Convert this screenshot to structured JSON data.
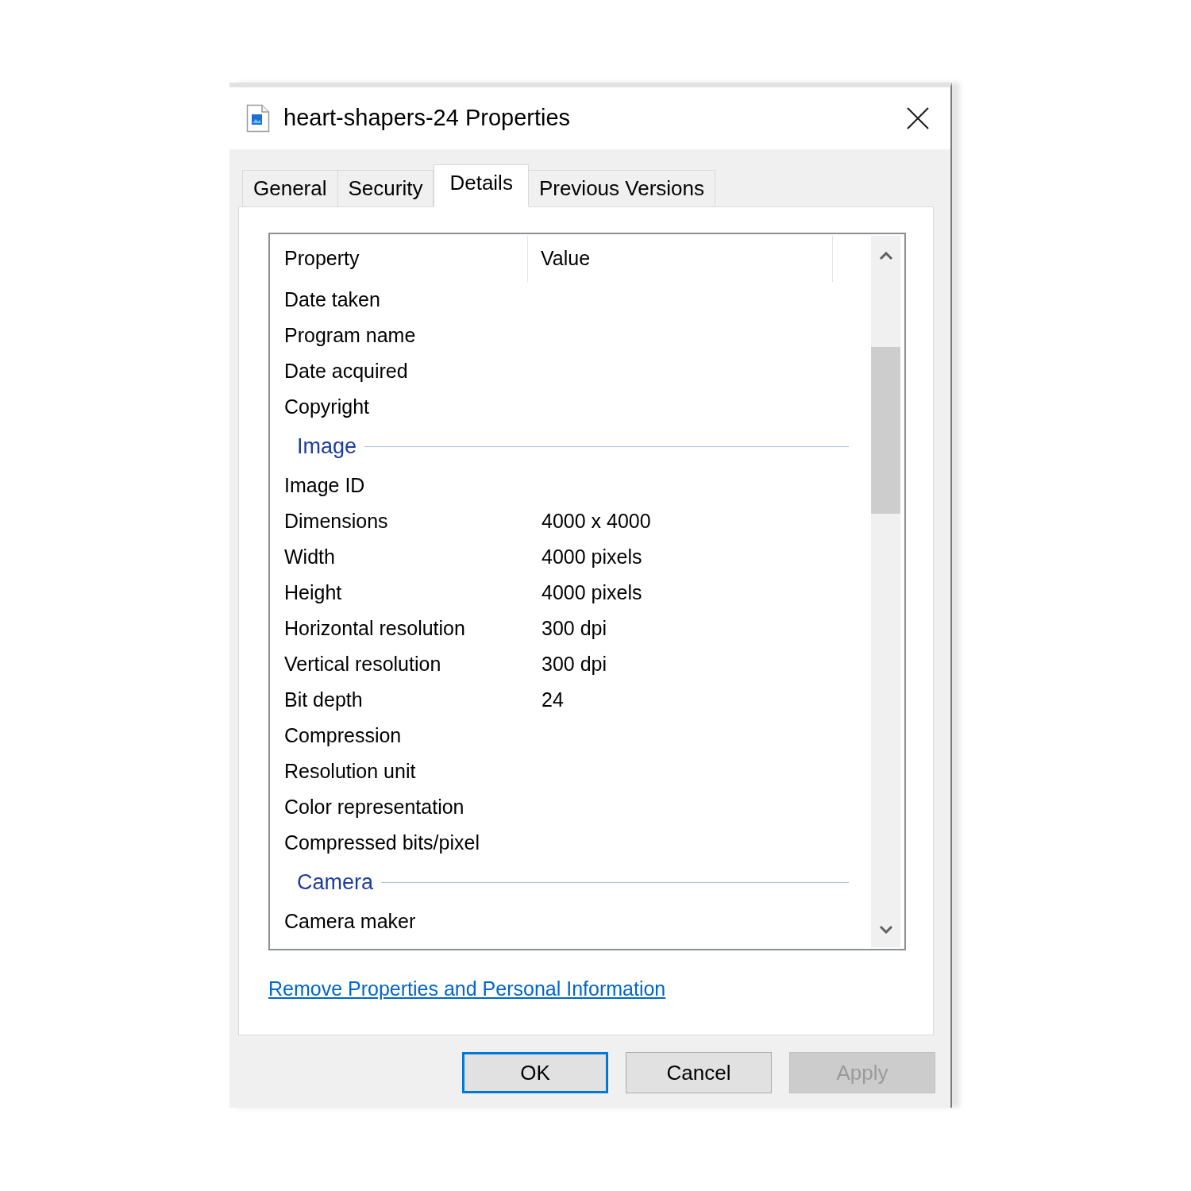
{
  "window": {
    "title": "heart-shapers-24 Properties"
  },
  "tabs": [
    {
      "label": "General",
      "selected": false
    },
    {
      "label": "Security",
      "selected": false
    },
    {
      "label": "Details",
      "selected": true
    },
    {
      "label": "Previous Versions",
      "selected": false
    }
  ],
  "details": {
    "columns": [
      "Property",
      "Value"
    ],
    "rows": [
      {
        "kind": "property",
        "property": "Date taken"
      },
      {
        "kind": "property",
        "property": "Program name"
      },
      {
        "kind": "property",
        "property": "Date acquired"
      },
      {
        "kind": "property",
        "property": "Copyright"
      },
      {
        "kind": "group",
        "label": "Image"
      },
      {
        "kind": "property",
        "property": "Image ID"
      },
      {
        "kind": "property",
        "property": "Dimensions",
        "value": "4000 x 4000"
      },
      {
        "kind": "property",
        "property": "Width",
        "value": "4000 pixels"
      },
      {
        "kind": "property",
        "property": "Height",
        "value": "4000 pixels"
      },
      {
        "kind": "property",
        "property": "Horizontal resolution",
        "value": "300 dpi"
      },
      {
        "kind": "property",
        "property": "Vertical resolution",
        "value": "300 dpi"
      },
      {
        "kind": "property",
        "property": "Bit depth",
        "value": "24"
      },
      {
        "kind": "property",
        "property": "Compression"
      },
      {
        "kind": "property",
        "property": "Resolution unit"
      },
      {
        "kind": "property",
        "property": "Color representation"
      },
      {
        "kind": "property",
        "property": "Compressed bits/pixel"
      },
      {
        "kind": "group",
        "label": "Camera"
      },
      {
        "kind": "property",
        "property": "Camera maker"
      }
    ]
  },
  "link": "Remove Properties and Personal Information",
  "buttons": [
    {
      "label": "OK",
      "default": true,
      "disabled": false
    },
    {
      "label": "Cancel",
      "default": false,
      "disabled": false
    },
    {
      "label": "Apply",
      "default": false,
      "disabled": true
    }
  ]
}
